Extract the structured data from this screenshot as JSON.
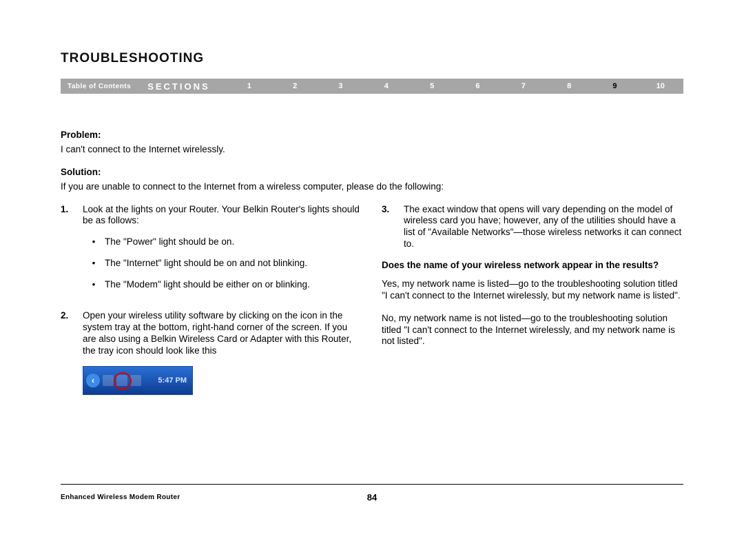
{
  "header": {
    "title": "TROUBLESHOOTING"
  },
  "nav": {
    "toc": "Table of Contents",
    "sections_label": "SECTIONS",
    "items": [
      "1",
      "2",
      "3",
      "4",
      "5",
      "6",
      "7",
      "8",
      "9",
      "10"
    ],
    "active_index": 8
  },
  "body": {
    "problem_label": "Problem:",
    "problem_text": "I can't connect to the Internet wirelessly.",
    "solution_label": "Solution:",
    "solution_intro": "If you are unable to connect to the Internet from a wireless computer, please do the following:",
    "step1_num": "1.",
    "step1_text": "Look at the lights on your Router. Your Belkin Router's lights should be as follows:",
    "step1_bullets": [
      "The \"Power\" light should be on.",
      "The \"Internet\" light should be on and not blinking.",
      "The \"Modem\" light should be either on or blinking."
    ],
    "step2_num": "2.",
    "step2_text": "Open your wireless utility software by clicking on the icon in the system tray at the bottom, right-hand corner of the screen. If you are also using a Belkin Wireless Card or Adapter with this Router, the tray icon should look like this",
    "tray_time": "5:47 PM",
    "step3_num": "3.",
    "step3_text": "The exact window that opens will vary depending on the model of wireless card you have; however, any of the utilities should have a list of \"Available Networks\"—those wireless networks it can connect to.",
    "question": "Does the name of your wireless network appear in the results?",
    "answer_yes": "Yes, my network name is listed—go to the troubleshooting solution titled \"I can't connect to the Internet wirelessly, but my network name is listed\".",
    "answer_no": "No, my network name is not listed—go to the troubleshooting solution titled \"I can't connect to the Internet wirelessly, and my network name is not listed\"."
  },
  "footer": {
    "product": "Enhanced Wireless Modem Router",
    "page": "84"
  }
}
